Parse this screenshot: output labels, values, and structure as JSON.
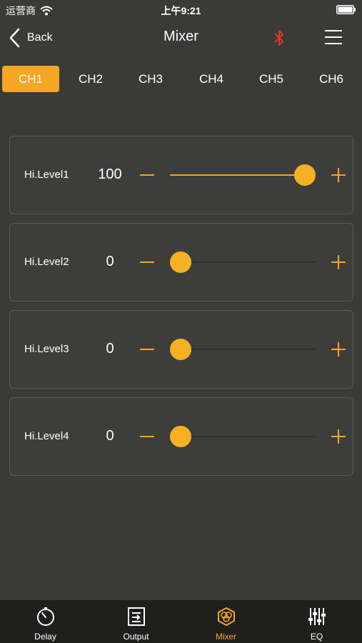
{
  "status_bar": {
    "carrier": "运营商",
    "time": "上午9:21"
  },
  "nav": {
    "back_label": "Back",
    "title": "Mixer"
  },
  "channels": [
    "CH1",
    "CH2",
    "CH3",
    "CH4",
    "CH5",
    "CH6"
  ],
  "active_channel": "CH1",
  "levels": [
    {
      "label": "Hi.Level1",
      "value": "100",
      "fraction": 1.0
    },
    {
      "label": "Hi.Level2",
      "value": "0",
      "fraction": 0.0
    },
    {
      "label": "Hi.Level3",
      "value": "0",
      "fraction": 0.0
    },
    {
      "label": "Hi.Level4",
      "value": "0",
      "fraction": 0.0
    }
  ],
  "tab_bar": {
    "items": [
      {
        "label": "Delay",
        "icon": "stopwatch-icon"
      },
      {
        "label": "Output",
        "icon": "output-icon"
      },
      {
        "label": "Mixer",
        "icon": "mixer-icon",
        "active": true
      },
      {
        "label": "EQ",
        "icon": "eq-sliders-icon"
      }
    ]
  },
  "colors": {
    "accent": "#f5a623",
    "background": "#3a3a38",
    "bluetooth": "#e0352b",
    "tab_bar": "#1f1f1e"
  }
}
